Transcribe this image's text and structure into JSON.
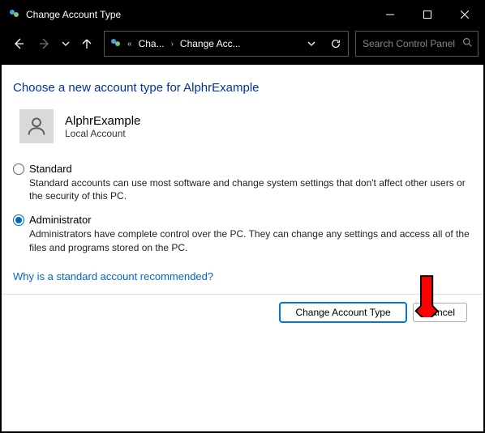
{
  "window": {
    "title": "Change Account Type"
  },
  "breadcrumb": {
    "seg1": "Cha...",
    "seg2": "Change Acc..."
  },
  "search": {
    "placeholder": "Search Control Panel"
  },
  "page": {
    "heading": "Choose a new account type for AlphrExample"
  },
  "user": {
    "name": "AlphrExample",
    "subtitle": "Local Account"
  },
  "options": {
    "standard": {
      "label": "Standard",
      "desc": "Standard accounts can use most software and change system settings that don't affect other users or the security of this PC."
    },
    "admin": {
      "label": "Administrator",
      "desc": "Administrators have complete control over the PC. They can change any settings and access all of the files and programs stored on the PC."
    }
  },
  "help_link": "Why is a standard account recommended?",
  "buttons": {
    "change": "Change Account Type",
    "cancel": "Cancel"
  }
}
